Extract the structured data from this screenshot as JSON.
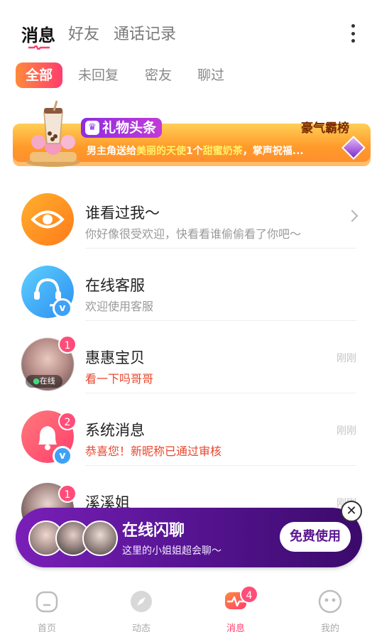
{
  "header": {
    "tabs": [
      {
        "label": "消息",
        "active": true
      },
      {
        "label": "好友",
        "active": false
      },
      {
        "label": "通话记录",
        "active": false
      }
    ],
    "more_icon": "more-vertical-icon"
  },
  "filters": [
    {
      "label": "全部",
      "active": true
    },
    {
      "label": "未回复",
      "active": false
    },
    {
      "label": "密友",
      "active": false
    },
    {
      "label": "聊过",
      "active": false
    }
  ],
  "banner": {
    "tag": "礼物头条",
    "rank_label": "豪气霸榜",
    "text_prefix": "男主角送给",
    "text_highlight1": "美丽的天使",
    "text_mid": "1个",
    "text_highlight2": "甜蜜奶茶",
    "text_suffix": "，掌声祝福..."
  },
  "messages": [
    {
      "title": "谁看过我～",
      "subtitle": "你好像很受欢迎，快看看谁偷偷看了你吧～",
      "time": "",
      "badge": "",
      "has_chevron": true
    },
    {
      "title": "在线客服",
      "subtitle": "欢迎使用客服",
      "time": "",
      "badge": ""
    },
    {
      "title": "惠惠宝贝",
      "subtitle": "看一下吗哥哥",
      "time": "刚刚",
      "badge": "1",
      "online_tag": "在线"
    },
    {
      "title": "系统消息",
      "subtitle": "恭喜您！新昵称已通过审核",
      "time": "刚刚",
      "badge": "2"
    },
    {
      "title": "溪溪姐",
      "subtitle": "",
      "time": "刚刚",
      "badge": "1"
    }
  ],
  "promo": {
    "title": "在线闪聊",
    "subtitle": "这里的小姐姐超会聊～",
    "button": "免费使用",
    "close": "✕"
  },
  "bottom_nav": [
    {
      "label": "首页",
      "icon": "home-icon",
      "active": false
    },
    {
      "label": "动态",
      "icon": "compass-icon",
      "active": false
    },
    {
      "label": "消息",
      "icon": "message-heart-icon",
      "active": true,
      "badge": "4"
    },
    {
      "label": "我的",
      "icon": "profile-face-icon",
      "active": false
    }
  ],
  "colors": {
    "accent": "#ff3d6e",
    "accent_orange": "#ff8a3c",
    "verified_blue": "#3ea1f5",
    "promo_purple": "#5c1699"
  }
}
